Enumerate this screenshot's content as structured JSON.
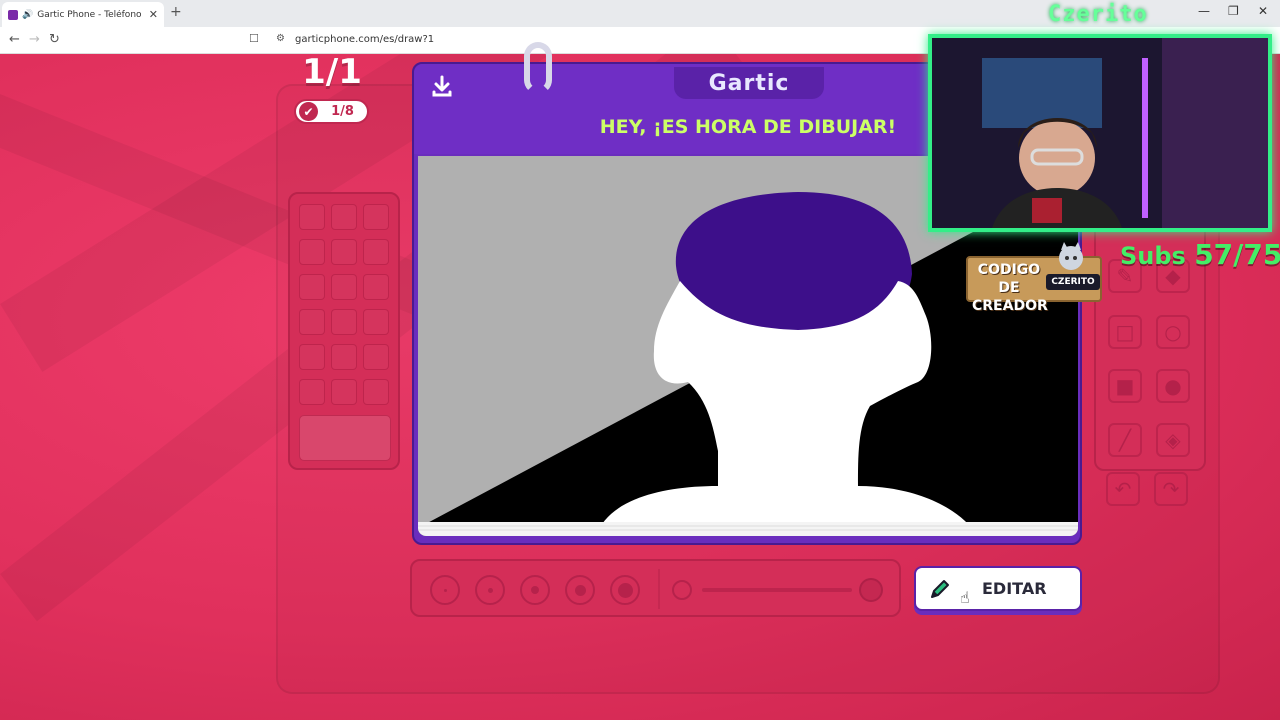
{
  "browser": {
    "tab_title": "Gartic Phone - Teléfono Desc",
    "tab_close": "✕",
    "new_tab": "+",
    "url": "garticphone.com/es/draw?1",
    "win_min": "—",
    "win_restore": "❐",
    "win_close": "✕",
    "back": "←",
    "forward": "→",
    "reload": "↻",
    "bookmark": "☐",
    "site_info": "⚙"
  },
  "game": {
    "round": "1/1",
    "done_count": "1/8",
    "done_icon": "✔",
    "logo": "Gartic",
    "heading": "HEY, ¡ES HORA DE DIBUJAR!",
    "edit_button": "EDITAR",
    "colors": {
      "page_bg": "#e2345c",
      "book": "#6a2dbd",
      "heading": "#ccff66",
      "hair": "#3d0f8a"
    },
    "tools": [
      {
        "name": "pencil-tool",
        "glyph": "✎"
      },
      {
        "name": "eraser-tool",
        "glyph": "◆"
      },
      {
        "name": "rectangle-tool",
        "glyph": "□"
      },
      {
        "name": "ellipse-tool",
        "glyph": "○"
      },
      {
        "name": "filled-rectangle-tool",
        "glyph": "■"
      },
      {
        "name": "filled-ellipse-tool",
        "glyph": "●"
      },
      {
        "name": "line-tool",
        "glyph": "╱"
      },
      {
        "name": "fill-tool",
        "glyph": "◈"
      },
      {
        "name": "undo-tool",
        "glyph": "↶"
      },
      {
        "name": "redo-tool",
        "glyph": "↷"
      }
    ],
    "brush_sizes": [
      1,
      2,
      3,
      4,
      5
    ]
  },
  "overlay": {
    "cam_title": "Czerito",
    "subs_label": "Subs",
    "subs_value": "57/75",
    "creator_text": "CODIGO DE CREADOR",
    "creator_tag": "CZERITO"
  }
}
